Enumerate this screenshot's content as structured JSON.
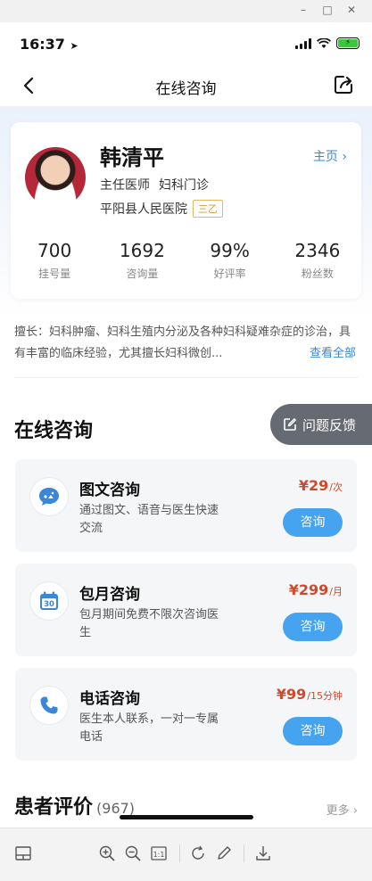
{
  "window": {
    "controls": [
      "minimize",
      "maximize",
      "close"
    ]
  },
  "status_bar": {
    "time": "16:37"
  },
  "nav": {
    "title": "在线咨询"
  },
  "doctor": {
    "name": "韩清平",
    "home_link": "主页",
    "title": "主任医师",
    "department": "妇科门诊",
    "hospital": "平阳县人民医院",
    "grade": "三乙",
    "stats": [
      {
        "value": "700",
        "label": "挂号量"
      },
      {
        "value": "1692",
        "label": "咨询量"
      },
      {
        "value": "99%",
        "label": "好评率"
      },
      {
        "value": "2346",
        "label": "粉丝数"
      }
    ],
    "expertise": "擅长：妇科肿瘤、妇科生殖内分泌及各种妇科疑难杂症的诊治，具有丰富的临床经验，尤其擅长妇科微创...",
    "see_all": "查看全部"
  },
  "consult": {
    "title": "在线咨询",
    "feedback": "问题反馈",
    "services": [
      {
        "name": "图文咨询",
        "desc": "通过图文、语音与医生快速交流",
        "price": "¥29",
        "unit": "/次",
        "button": "咨询",
        "icon": "chat-icon"
      },
      {
        "name": "包月咨询",
        "desc": "包月期间免费不限次咨询医生",
        "price": "¥299",
        "unit": "/月",
        "button": "咨询",
        "icon": "calendar-icon",
        "icon_text": "30"
      },
      {
        "name": "电话咨询",
        "desc": "医生本人联系，一对一专属电话",
        "price": "¥99",
        "unit": "/15分钟",
        "button": "咨询",
        "icon": "phone-icon"
      }
    ]
  },
  "reviews": {
    "title": "患者评价",
    "count": "(967)",
    "more": "更多"
  },
  "colors": {
    "accent": "#3a86d8",
    "button": "#45a3ef",
    "price": "#cc4a2e",
    "grade": "#d59a33"
  }
}
